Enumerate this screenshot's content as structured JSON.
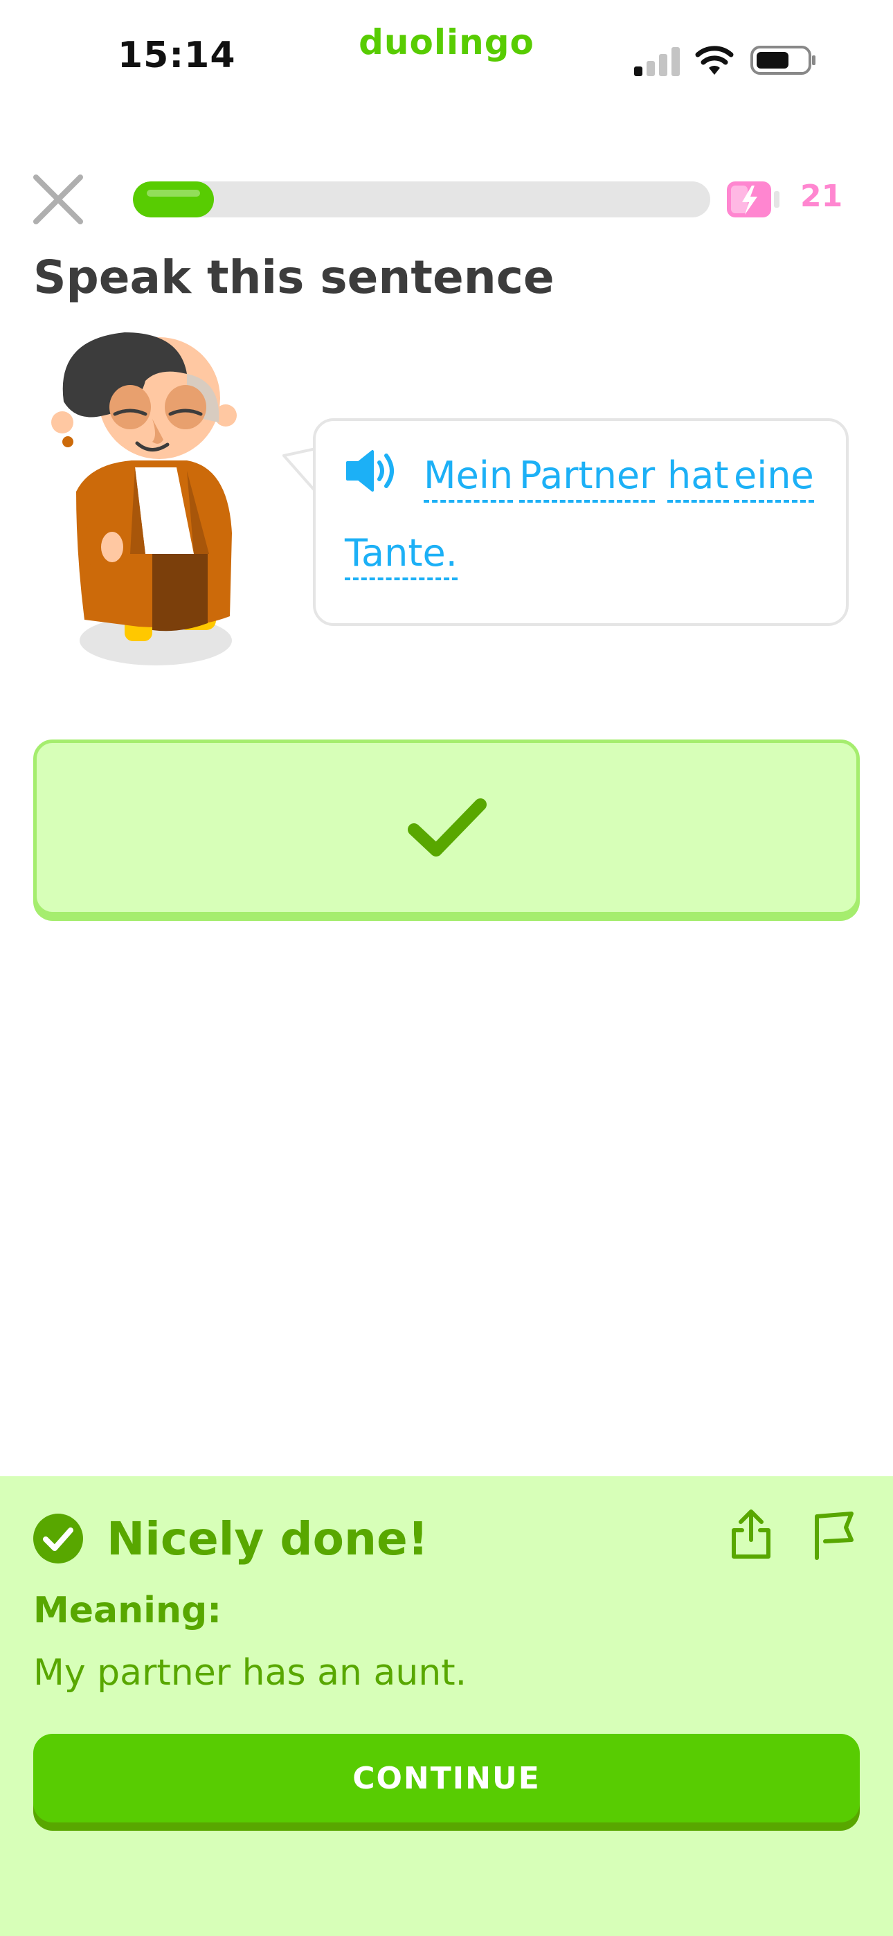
{
  "status_bar": {
    "time": "15:14",
    "app_name": "duolingo"
  },
  "top_bar": {
    "progress_fraction": 0.14,
    "energy_count": "21"
  },
  "challenge": {
    "title": "Speak this sentence",
    "sentence_words": [
      "Mein",
      "Partner",
      "hat",
      "eine",
      "Tante."
    ]
  },
  "feedback": {
    "title": "Nicely done!",
    "meaning_label": "Meaning:",
    "meaning_text": "My partner has an aunt.",
    "continue_label": "CONTINUE"
  },
  "colors": {
    "brand_green": "#58cc02",
    "dark_green": "#58a700",
    "light_green_bg": "#d7ffb8",
    "link_blue": "#1cb0f6",
    "energy_pink": "#ff86d0"
  },
  "icons": [
    "signal-icon",
    "wifi-icon",
    "battery-icon",
    "close-icon",
    "energy-icon",
    "speaker-icon",
    "check-icon",
    "share-icon",
    "flag-icon"
  ]
}
